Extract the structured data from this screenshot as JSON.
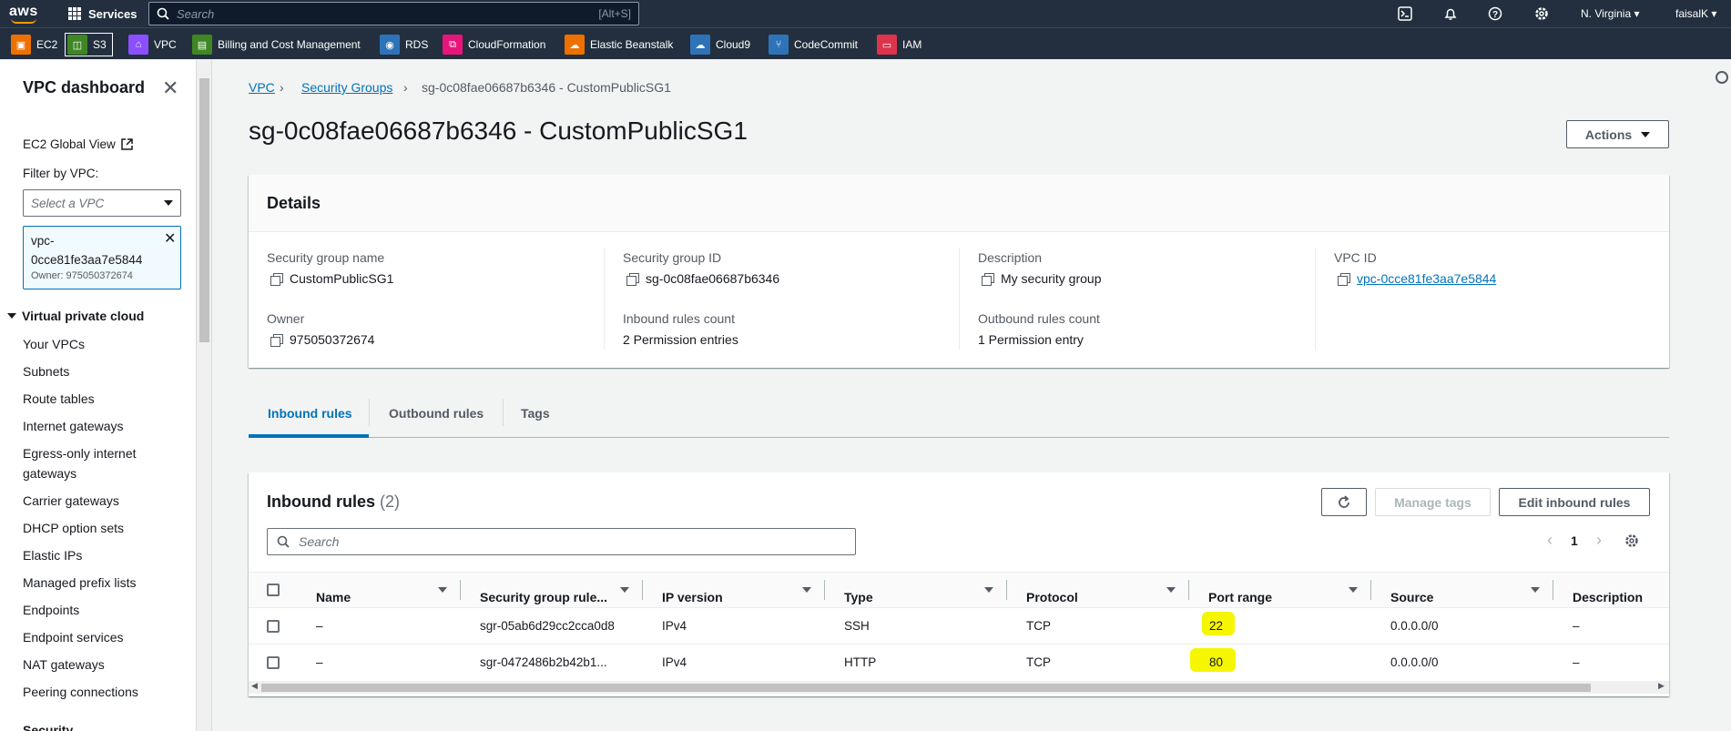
{
  "topnav": {
    "logo": "aws",
    "services_label": "Services",
    "search_placeholder": "Search",
    "search_shortcut": "[Alt+S]",
    "region": "N. Virginia ▾",
    "user": "faisalK ▾",
    "icons": [
      "cloudshell-icon",
      "bell-icon",
      "help-icon",
      "gear-icon"
    ]
  },
  "favorites": [
    {
      "label": "EC2",
      "color": "#ed7100",
      "icon": "ec2-icon"
    },
    {
      "label": "S3",
      "color": "#3f8624",
      "icon": "s3-icon"
    },
    {
      "label": "VPC",
      "color": "#8c4fff",
      "icon": "vpc-icon"
    },
    {
      "label": "Billing and Cost Management",
      "color": "#3f8624",
      "icon": "billing-icon"
    },
    {
      "label": "RDS",
      "color": "#2e73b8",
      "icon": "rds-icon"
    },
    {
      "label": "CloudFormation",
      "color": "#e7157b",
      "icon": "cloudformation-icon"
    },
    {
      "label": "Elastic Beanstalk",
      "color": "#ed7100",
      "icon": "beanstalk-icon"
    },
    {
      "label": "Cloud9",
      "color": "#2e73b8",
      "icon": "cloud9-icon"
    },
    {
      "label": "CodeCommit",
      "color": "#2e73b8",
      "icon": "codecommit-icon"
    },
    {
      "label": "IAM",
      "color": "#dd344c",
      "icon": "iam-icon"
    }
  ],
  "sidebar": {
    "title": "VPC dashboard",
    "ec2_global_view": "EC2 Global View",
    "filter_label": "Filter by VPC:",
    "select_placeholder": "Select a VPC",
    "token_line1": "vpc-",
    "token_line2": "0cce81fe3aa7e5844",
    "token_owner": "Owner: 975050372674",
    "section": "Virtual private cloud",
    "items": [
      "Your VPCs",
      "Subnets",
      "Route tables",
      "Internet gateways",
      "Egress-only internet gateways",
      "Carrier gateways",
      "DHCP option sets",
      "Elastic IPs",
      "Managed prefix lists",
      "Endpoints",
      "Endpoint services",
      "NAT gateways",
      "Peering connections"
    ],
    "next_section": "Security"
  },
  "breadcrumb": {
    "vpc": "VPC",
    "sg": "Security Groups",
    "current": "sg-0c08fae06687b6346 - CustomPublicSG1"
  },
  "page_title": "sg-0c08fae06687b6346 - CustomPublicSG1",
  "actions_label": "Actions",
  "details": {
    "heading": "Details",
    "sg_name_label": "Security group name",
    "sg_name": "CustomPublicSG1",
    "sg_id_label": "Security group ID",
    "sg_id": "sg-0c08fae06687b6346",
    "desc_label": "Description",
    "desc": "My security group",
    "vpc_id_label": "VPC ID",
    "vpc_id": "vpc-0cce81fe3aa7e5844",
    "owner_label": "Owner",
    "owner": "975050372674",
    "inbound_count_label": "Inbound rules count",
    "inbound_count": "2 Permission entries",
    "outbound_count_label": "Outbound rules count",
    "outbound_count": "1 Permission entry"
  },
  "tabs": [
    "Inbound rules",
    "Outbound rules",
    "Tags"
  ],
  "inbound": {
    "heading": "Inbound rules",
    "count": "(2)",
    "manage_tags": "Manage tags",
    "edit_rules": "Edit inbound rules",
    "search_placeholder": "Search",
    "page": "1",
    "columns": [
      "Name",
      "Security group rule...",
      "IP version",
      "Type",
      "Protocol",
      "Port range",
      "Source",
      "Description"
    ],
    "rows": [
      {
        "name": "–",
        "rule_id": "sgr-05ab6d29cc2cca0d8",
        "ip_version": "IPv4",
        "type": "SSH",
        "protocol": "TCP",
        "port_range": "22",
        "source": "0.0.0.0/0",
        "description": "–"
      },
      {
        "name": "–",
        "rule_id": "sgr-0472486b2b42b1...",
        "ip_version": "IPv4",
        "type": "HTTP",
        "protocol": "TCP",
        "port_range": "80",
        "source": "0.0.0.0/0",
        "description": "–"
      }
    ]
  }
}
